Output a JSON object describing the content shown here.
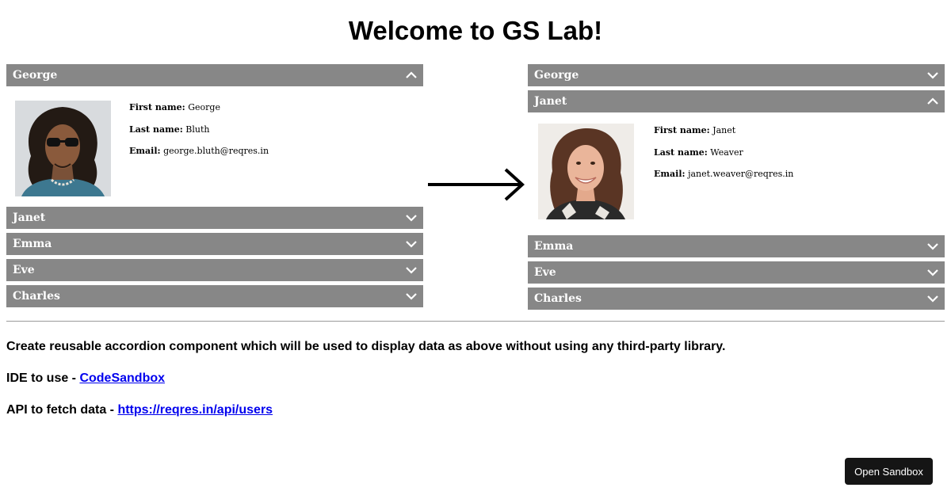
{
  "page": {
    "title": "Welcome to GS Lab!"
  },
  "left_accordion": {
    "items": [
      {
        "name": "George",
        "expanded": true
      },
      {
        "name": "Janet",
        "expanded": false
      },
      {
        "name": "Emma",
        "expanded": false
      },
      {
        "name": "Eve",
        "expanded": false
      },
      {
        "name": "Charles",
        "expanded": false
      }
    ],
    "open_user": {
      "first_name_label": "First name:",
      "first_name": "George",
      "last_name_label": "Last name:",
      "last_name": "Bluth",
      "email_label": "Email:",
      "email": "george.bluth@reqres.in"
    }
  },
  "right_accordion": {
    "items": [
      {
        "name": "George",
        "expanded": false
      },
      {
        "name": "Janet",
        "expanded": true
      },
      {
        "name": "Emma",
        "expanded": false
      },
      {
        "name": "Eve",
        "expanded": false
      },
      {
        "name": "Charles",
        "expanded": false
      }
    ],
    "open_user": {
      "first_name_label": "First name:",
      "first_name": "Janet",
      "last_name_label": "Last name:",
      "last_name": "Weaver",
      "email_label": "Email:",
      "email": "janet.weaver@reqres.in"
    }
  },
  "description": {
    "task": "Create reusable accordion component which will be used to display data as above without using any third-party library.",
    "ide_prefix": "IDE to use - ",
    "ide_link": "CodeSandbox",
    "api_prefix": "API to fetch data - ",
    "api_link": "https://reqres.in/api/users"
  },
  "footer": {
    "open_sandbox_label": "Open Sandbox"
  },
  "icons": {
    "expanded": "chevron-up-icon",
    "collapsed": "chevron-down-icon",
    "arrow": "arrow-right-icon"
  },
  "colors": {
    "header_bg": "#878787",
    "header_text": "#ffffff",
    "link": "#0000ee",
    "button_bg": "#151515"
  }
}
